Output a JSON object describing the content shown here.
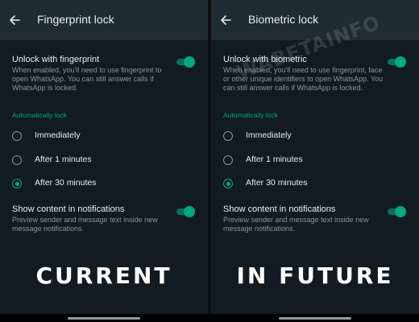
{
  "panels": [
    {
      "title": "Fingerprint lock",
      "unlock_title": "Unlock with fingerprint",
      "unlock_desc": "When enabled, you'll need to use fingerprint to open WhatsApp. You can still answer calls if WhatsApp is locked.",
      "unlock_enabled": true,
      "section_label": "Automatically lock",
      "options": [
        "Immediately",
        "After 1 minutes",
        "After 30 minutes"
      ],
      "selected_option": "After 30 minutes",
      "notif_title": "Show content in notifications",
      "notif_desc": "Preview sender and message text inside new message notifications.",
      "notif_enabled": true,
      "caption": "CURRENT"
    },
    {
      "title": "Biometric lock",
      "unlock_title": "Unlock with biometric",
      "unlock_desc": "When enabled, you'll need to use fingerprint, face or other unique identifiers to open WhatsApp. You can still answer calls if WhatsApp is locked.",
      "unlock_enabled": true,
      "section_label": "Automatically lock",
      "options": [
        "Immediately",
        "After 1 minutes",
        "After 30 minutes"
      ],
      "selected_option": "After 30 minutes",
      "notif_title": "Show content in notifications",
      "notif_desc": "Preview sender and message text inside new message notifications.",
      "notif_enabled": true,
      "caption": "IN FUTURE",
      "watermark": "WABETAINFO"
    }
  ],
  "colors": {
    "background": "#111b21",
    "app_bar": "#202c33",
    "accent": "#00a884",
    "primary_text": "#e9edef",
    "secondary_text": "#8696a0"
  },
  "icons": {
    "back": "arrow-left-icon"
  }
}
